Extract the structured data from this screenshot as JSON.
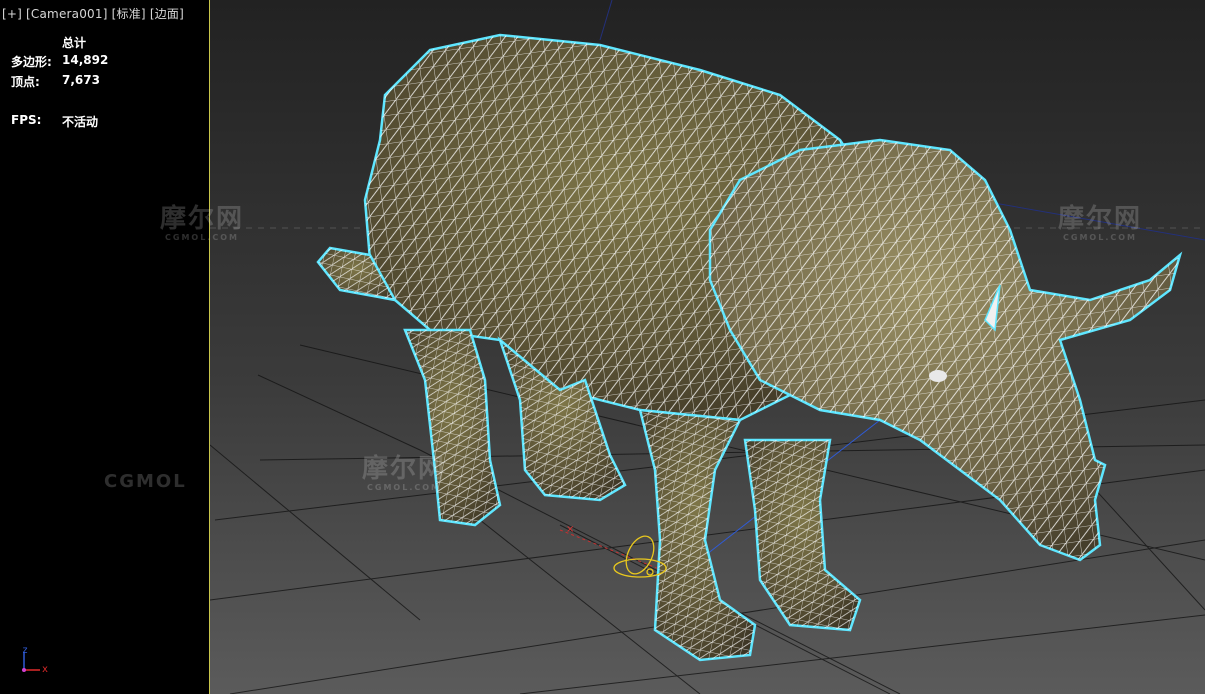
{
  "viewport": {
    "labels": [
      "[+]",
      "[Camera001]",
      "[标准]",
      "[边面]"
    ]
  },
  "stats": {
    "header": "总计",
    "polygons_label": "多边形:",
    "polygons_value": "14,892",
    "vertices_label": "顶点:",
    "vertices_value": "7,673",
    "fps_label": "FPS:",
    "fps_value": "不活动"
  },
  "watermarks": {
    "main": "摩尔网",
    "sub": "CGMOL.COM",
    "side": "CGMOL"
  },
  "axis_gizmo": {
    "z": "z",
    "x": "x"
  },
  "colors": {
    "panel_border": "#c9c64a",
    "selection_outline": "#5ee6ff",
    "wireframe": "#ffffff",
    "grid_line": "#0a0a0a",
    "x_axis": "#e02a2a",
    "z_axis": "#2f5bd6"
  }
}
